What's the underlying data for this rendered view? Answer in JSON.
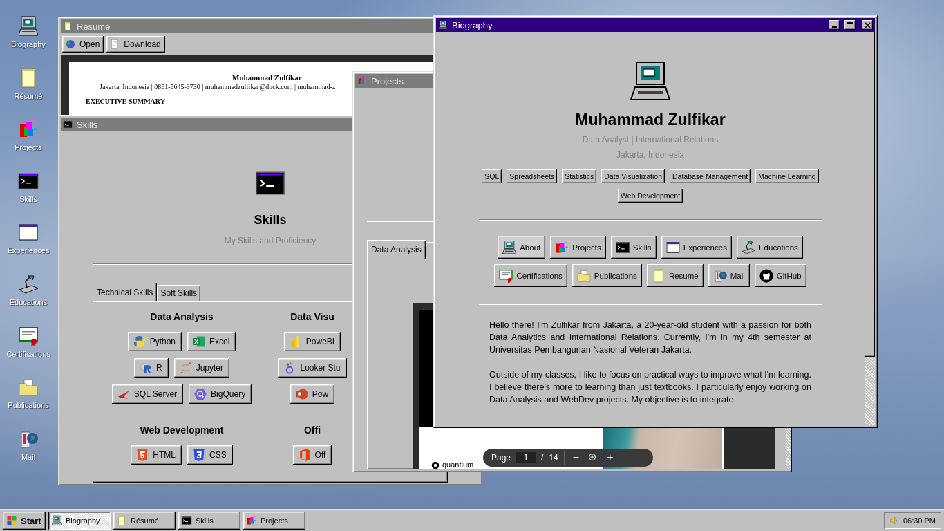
{
  "desktop_icons": [
    {
      "label": "Biography",
      "kind": "computer"
    },
    {
      "label": "Résumé",
      "kind": "notepad"
    },
    {
      "label": "Projects",
      "kind": "blocks"
    },
    {
      "label": "Skills",
      "kind": "terminal"
    },
    {
      "label": "Experiences",
      "kind": "window"
    },
    {
      "label": "Educations",
      "kind": "lamp"
    },
    {
      "label": "Certifications",
      "kind": "certificate"
    },
    {
      "label": "Publications",
      "kind": "folder"
    },
    {
      "label": "Mail",
      "kind": "mail"
    }
  ],
  "resume_window": {
    "title": "Résumé",
    "kind": "notepad",
    "active": false,
    "toolbar": [
      {
        "label": "Open",
        "kind": "globe"
      },
      {
        "label": "Download",
        "kind": "document"
      }
    ],
    "document": {
      "name": "Muhammad Zulfikar",
      "contact": "Jakarta, Indonesia | 0851-5645-3730 | muhammadzulfikar@duck.com | muhammad-z",
      "heading": "EXECUTIVE SUMMARY"
    }
  },
  "skills_window": {
    "title": "Skills",
    "kind": "terminal",
    "active": false,
    "heading": "Skills",
    "subtitle": "My Skills and Proficiency",
    "tabs": [
      {
        "label": "Technical Skills",
        "selected": true
      },
      {
        "label": "Soft Skills",
        "selected": false
      }
    ],
    "groups": [
      {
        "title": "Data Analysis",
        "rows": [
          [
            {
              "label": "Python",
              "kind": "python"
            },
            {
              "label": "Excel",
              "kind": "excel"
            }
          ],
          [
            {
              "label": "R",
              "kind": "r"
            },
            {
              "label": "Jupyter",
              "kind": "jupyter"
            }
          ],
          [
            {
              "label": "SQL Server",
              "kind": "sqlserver"
            },
            {
              "label": "BigQuery",
              "kind": "bigquery"
            }
          ]
        ]
      },
      {
        "title": "Data Visu",
        "rows": [
          [
            {
              "label": "PoweBI",
              "kind": "powerbi"
            }
          ],
          [
            {
              "label": "Looker Stu",
              "kind": "looker"
            }
          ],
          [
            {
              "label": "Pow",
              "kind": "powerpoint"
            }
          ]
        ]
      },
      {
        "title": "Web Development",
        "rows": [
          [
            {
              "label": "HTML",
              "kind": "html"
            },
            {
              "label": "CSS",
              "kind": "css"
            }
          ]
        ]
      },
      {
        "title": "Offi",
        "rows": [
          [
            {
              "label": "Off",
              "kind": "office"
            }
          ]
        ]
      }
    ]
  },
  "projects_window": {
    "title": "Projects",
    "kind": "blocks",
    "active": false,
    "tabs": [
      {
        "label": "Data Analysis",
        "selected": true
      },
      {
        "selected": false
      }
    ],
    "pdf_viewer": {
      "logo_text": "quantium",
      "page_label": "Page",
      "page": "1",
      "separator": "/",
      "total_pages": "14",
      "zoom_out": "−",
      "zoom_in": "+"
    }
  },
  "biography_window": {
    "title": "Biography",
    "kind": "computer",
    "active": true,
    "name": "Muhammad Zulfikar",
    "headline": "Data Analyst | International Relations",
    "location": "Jakarta, Indonesia",
    "tags": [
      "SQL",
      "Spreadsheets",
      "Statistics",
      "Data Visualization",
      "Database Management",
      "Machine Learning",
      "Web Development"
    ],
    "nav_buttons": [
      {
        "label": "About",
        "kind": "computer",
        "selected": true
      },
      {
        "label": "Projects",
        "kind": "blocks",
        "selected": false
      },
      {
        "label": "Skills",
        "kind": "terminal",
        "selected": false
      },
      {
        "label": "Experiences",
        "kind": "window",
        "selected": false
      },
      {
        "label": "Educations",
        "kind": "lamp",
        "selected": false
      },
      {
        "label": "Certifications",
        "kind": "certificate",
        "selected": false
      },
      {
        "label": "Publications",
        "kind": "folder",
        "selected": false
      },
      {
        "label": "Resume",
        "kind": "notepad",
        "selected": false
      },
      {
        "label": "Mail",
        "kind": "mail",
        "selected": false
      },
      {
        "label": "GitHub",
        "kind": "github",
        "selected": false
      }
    ],
    "paragraphs": [
      "Hello there! I'm Zulfikar from Jakarta, a 20-year-old student with a passion for both Data Analytics and International Relations. Currently, I'm in my 4th semester at Universitas Pembangunan Nasional Veteran Jakarta.",
      "Outside of my classes, I like to focus on practical ways to improve what I'm learning. I believe there's more to learning than just textbooks. I particularly enjoy working on Data Analysis and WebDev projects. My objective is to integrate"
    ]
  },
  "taskbar": {
    "start": "Start",
    "tasks": [
      {
        "label": "Biography",
        "kind": "computer",
        "selected": true
      },
      {
        "label": "Résumé",
        "kind": "notepad",
        "selected": false
      },
      {
        "label": "Skills",
        "kind": "terminal",
        "selected": false
      },
      {
        "label": "Projects",
        "kind": "blocks",
        "selected": false
      }
    ],
    "clock": "06:30 PM"
  }
}
